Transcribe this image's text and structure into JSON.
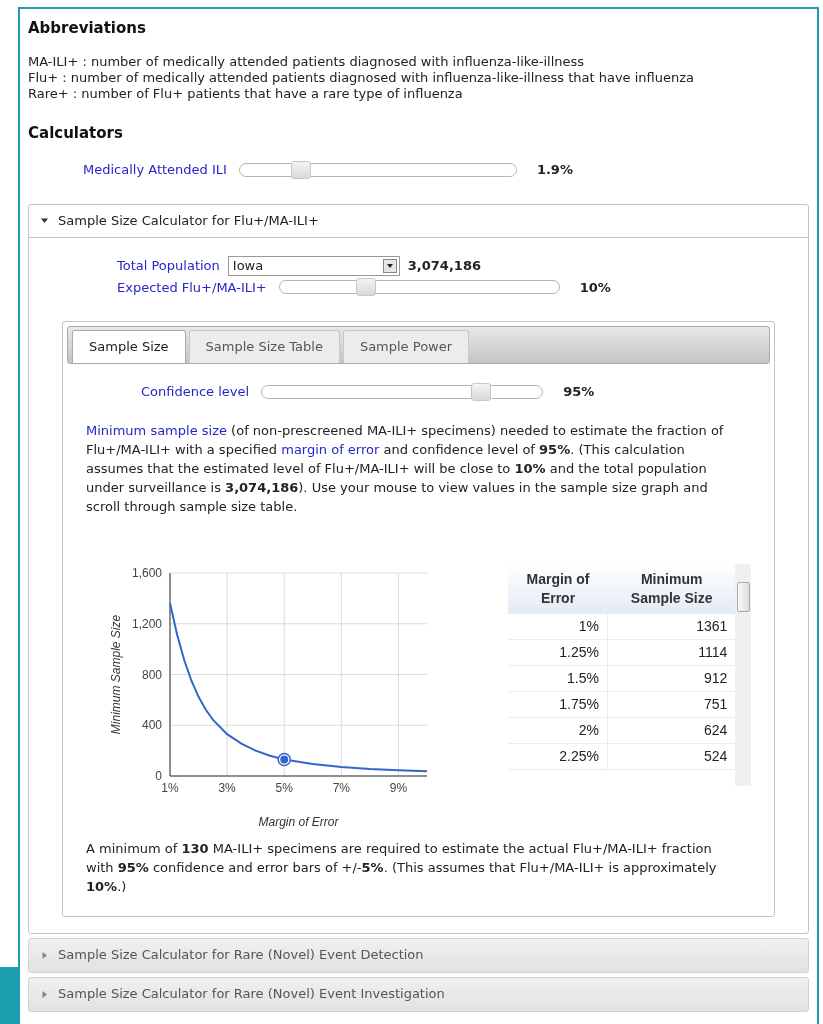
{
  "abbreviations": {
    "title": "Abbreviations",
    "lines": [
      "MA-ILI+ : number of medically attended patients diagnosed with influenza-like-illness",
      "Flu+ : number of medically attended patients diagnosed with influenza-like-illness that have influenza",
      "Rare+ : number of Flu+ patients that have a rare type of influenza"
    ]
  },
  "calculators": {
    "title": "Calculators",
    "ili_slider": {
      "label": "Medically Attended ILI",
      "level": 0.22,
      "reading": "1.9%"
    }
  },
  "sections": [
    {
      "title": "Sample Size Calculator for Flu+/MA-ILI+",
      "expanded": true,
      "calculator": {
        "population": {
          "label": "Total Population",
          "value": "Iowa",
          "reading": "3,074,186"
        },
        "expected": {
          "label": "Expected Flu+/MA-ILI+",
          "level": 0.31,
          "reading": "10%"
        },
        "tabs": [
          {
            "label": "Sample Size",
            "selected": true
          },
          {
            "label": "Sample Size Table",
            "selected": false
          },
          {
            "label": "Sample Power",
            "selected": false
          }
        ],
        "confidence": {
          "label": "Confidence level",
          "level": 0.78,
          "reading": "95%"
        },
        "description": [
          {
            "kind": "link",
            "text": "Minimum sample size"
          },
          {
            "kind": "text",
            "text": " (of non-prescreened MA-ILI+ specimens) needed to estimate the fraction of Flu+/MA-ILI+ with a specified "
          },
          {
            "kind": "link",
            "text": "margin of error"
          },
          {
            "kind": "text",
            "text": " and confidence level of **95%**. (This calculation assumes that the estimated level of Flu+/MA-ILI+ will be close to **10%** and the total population under surveillance is **3,074,186**). Use your mouse to view values in the sample size graph and scroll through sample size table."
          }
        ],
        "chart_data": {
          "type": "line",
          "xlabel": "Margin of Error",
          "ylabel": "Minimum Sample Size",
          "x": [
            1,
            1.25,
            1.5,
            1.75,
            2,
            2.25,
            2.5,
            3,
            3.5,
            4,
            4.5,
            5,
            6,
            7,
            8,
            9,
            10
          ],
          "series": [
            {
              "color": "#3366cc",
              "values": [
                1361,
                1114,
                912,
                751,
                624,
                524,
                444,
                330,
                255,
                200,
                160,
                130,
                95,
                70,
                55,
                45,
                38
              ]
            }
          ],
          "xlim": [
            1,
            10
          ],
          "ylim": [
            0,
            1600
          ],
          "xticks": [
            {
              "value": 1,
              "label": "1%"
            },
            {
              "value": 3,
              "label": "3%"
            },
            {
              "value": 5,
              "label": "5%"
            },
            {
              "value": 7,
              "label": "7%"
            },
            {
              "value": 9,
              "label": "9%"
            }
          ],
          "yticks": [
            {
              "value": 0,
              "label": "0"
            },
            {
              "value": 400,
              "label": "400"
            },
            {
              "value": 800,
              "label": "800"
            },
            {
              "value": 1200,
              "label": "1,200"
            },
            {
              "value": 1600,
              "label": "1,600"
            }
          ],
          "grid": true
        },
        "table": {
          "columns": [
            "Margin of Error",
            "Minimum Sample Size"
          ],
          "rows": [
            [
              "1%",
              "1361"
            ],
            [
              "1.25%",
              "1114"
            ],
            [
              "1.5%",
              "912"
            ],
            [
              "1.75%",
              "751"
            ],
            [
              "2%",
              "624"
            ],
            [
              "2.25%",
              "524"
            ]
          ]
        },
        "result": "A minimum of **130** MA-ILI+ specimens are required to estimate the actual Flu+/MA-ILI+ fraction with **95%** confidence and error bars of +/-**5%**. (This assumes that Flu+/MA-ILI+ is approximately **10%**.)"
      }
    },
    {
      "title": "Sample Size Calculator for Rare (Novel) Event Detection",
      "expanded": false
    },
    {
      "title": "Sample Size Calculator for Rare (Novel) Event Investigation",
      "expanded": false
    }
  ]
}
